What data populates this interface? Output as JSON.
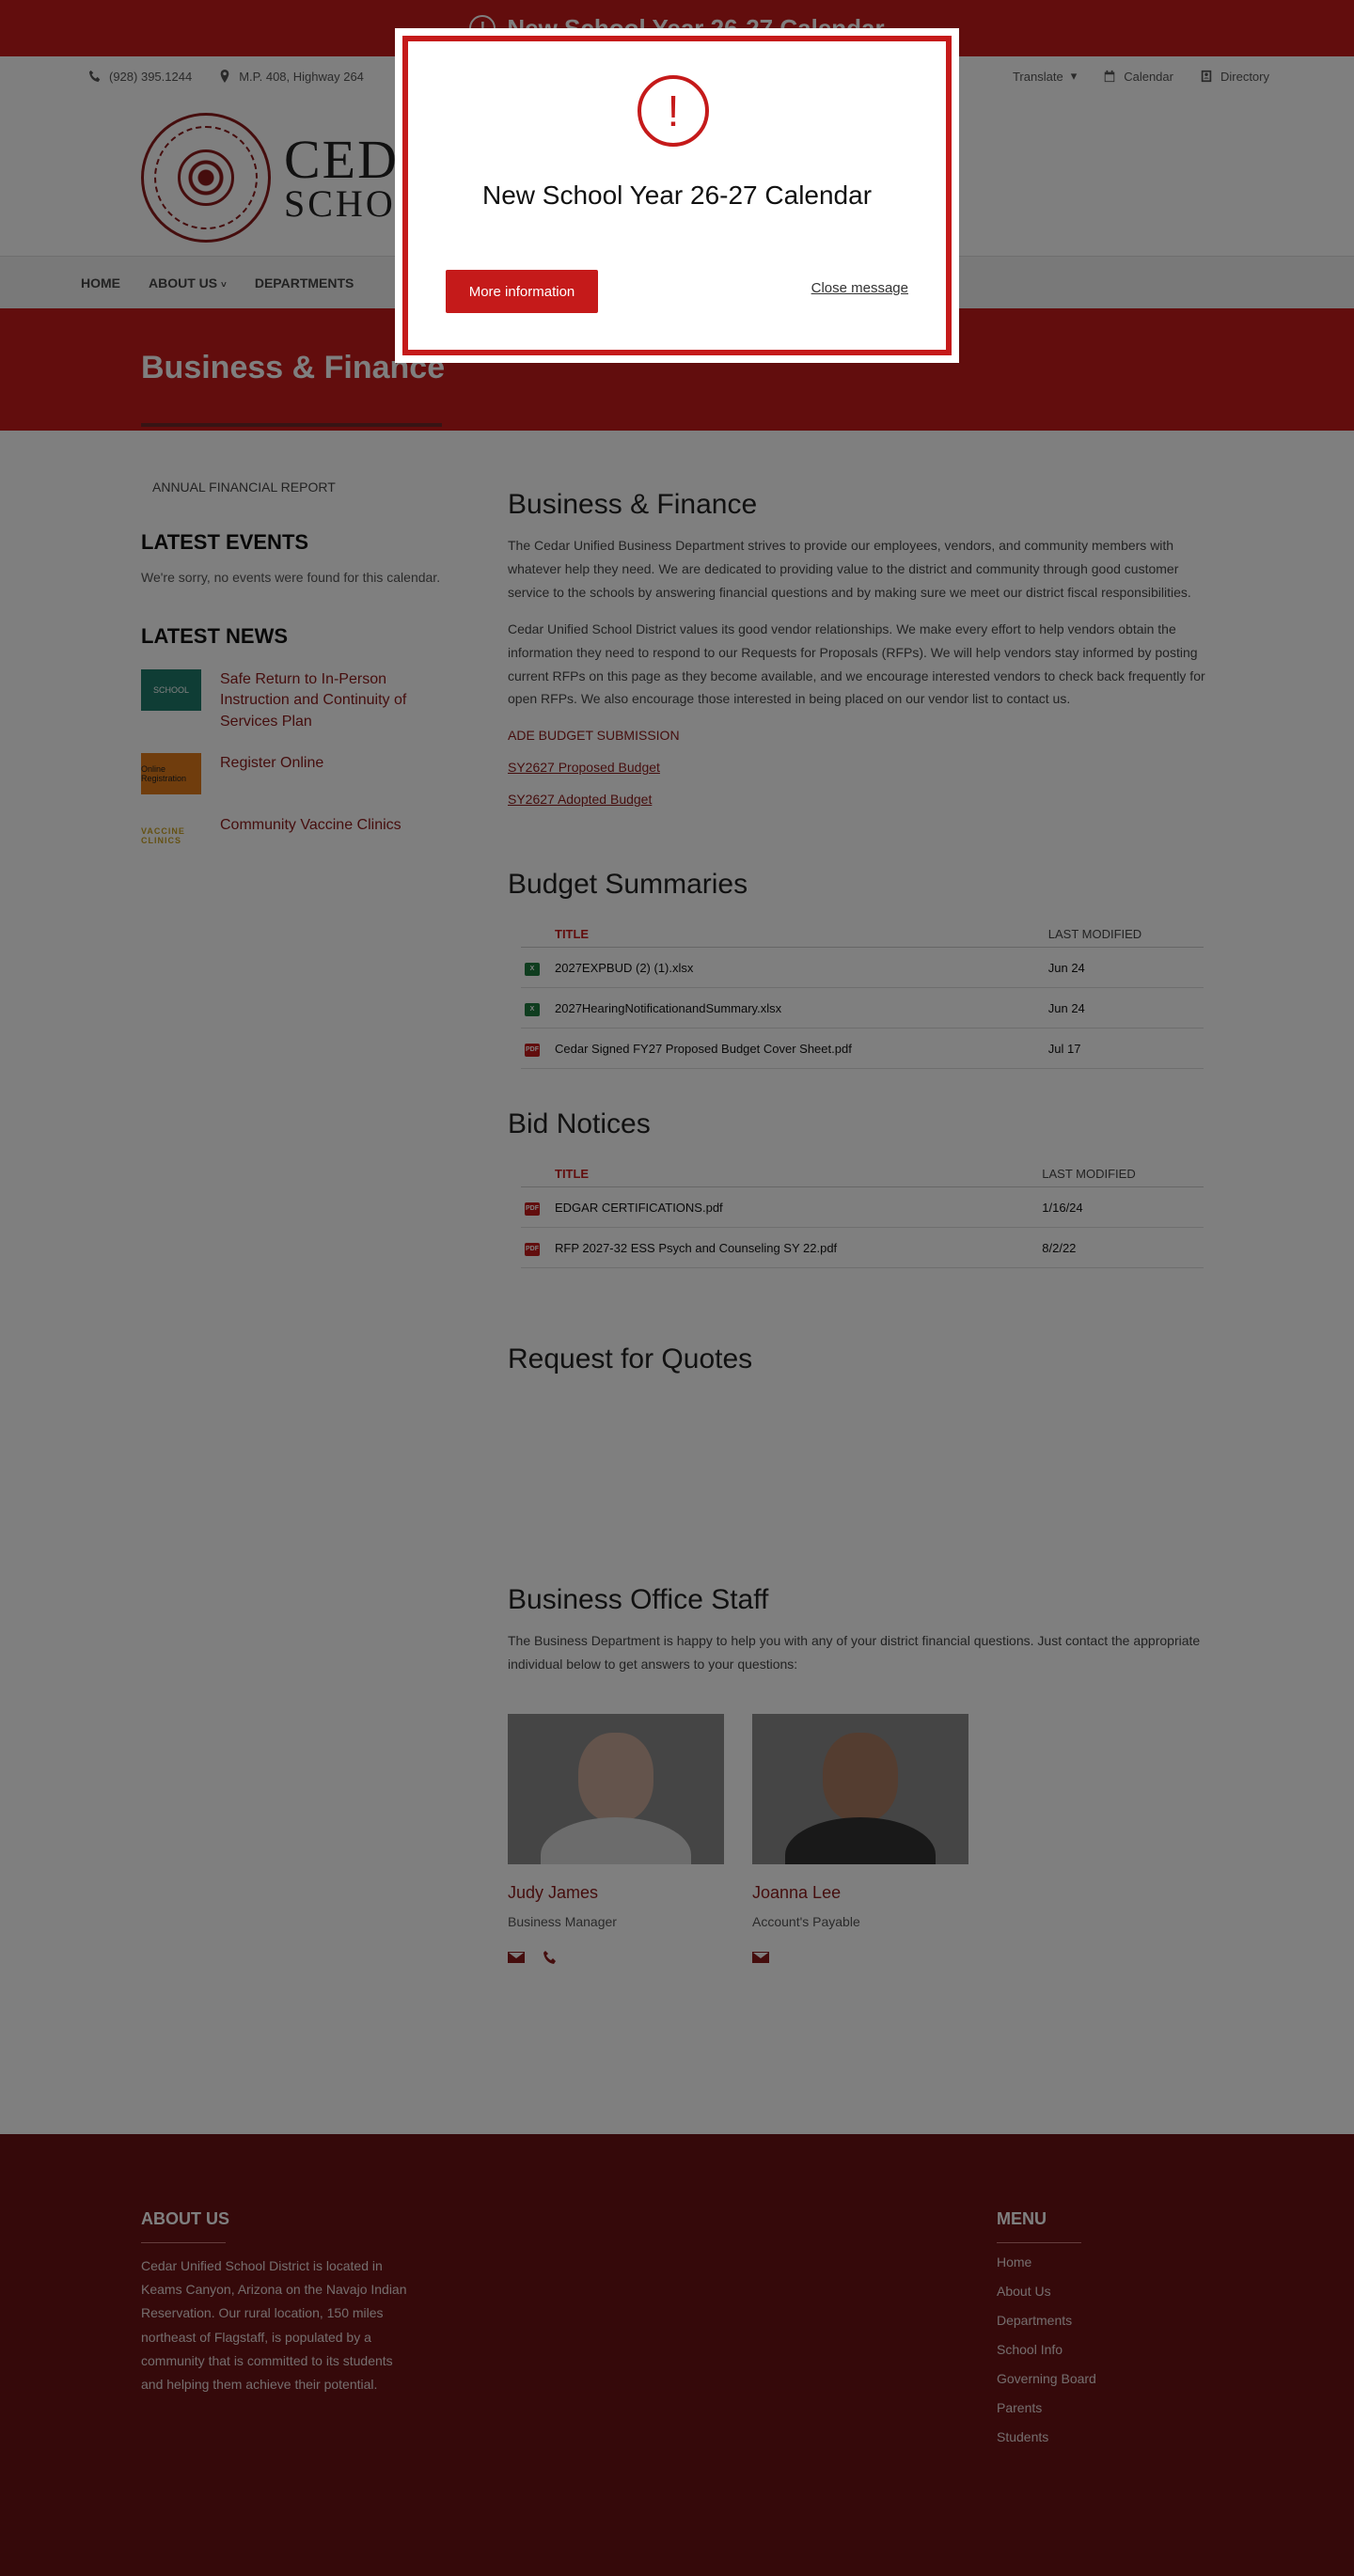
{
  "alert_bar": {
    "text": "New School Year 26-27 Calendar"
  },
  "utility": {
    "phone": "(928) 395.1244",
    "address": "M.P. 408, Highway 264",
    "translate": "Translate",
    "calendar": "Calendar",
    "directory": "Directory"
  },
  "brand": {
    "line1": "CEDAR",
    "line2": "SCHOOL"
  },
  "nav": {
    "items": [
      "HOME",
      "ABOUT US",
      "DEPARTMENTS"
    ]
  },
  "banner": {
    "title": "Business & Finance"
  },
  "sidebar": {
    "link": "ANNUAL FINANCIAL REPORT",
    "events_heading": "LATEST EVENTS",
    "events_empty": "We're sorry, no events were found for this calendar.",
    "news_heading": "LATEST NEWS",
    "news": [
      {
        "title": "Safe Return to In-Person Instruction and Continuity of Services Plan",
        "thumb_text": "SCHOOL",
        "thumb_color": "#1f7a6a"
      },
      {
        "title": "Register Online",
        "thumb_text": "Online Registration",
        "thumb_color": "#e07a1a"
      },
      {
        "title": "Community Vaccine Clinics",
        "thumb_text": "VACCINE CLINICS",
        "thumb_color": "#ffffff"
      }
    ]
  },
  "main": {
    "title": "Business & Finance",
    "para1": "The Cedar Unified Business Department strives to provide our employees, vendors, and community members with whatever help they need. We are dedicated to providing value to the district and community through good customer service to the schools by answering financial questions and by making sure we meet our district fiscal responsibilities.",
    "para2": "Cedar Unified School District values its good vendor relationships. We make every effort to help vendors obtain the information they need to respond to our Requests for Proposals (RFPs). We will help vendors stay informed by posting current RFPs on this page as they become available, and we encourage interested vendors to check back frequently for open RFPs. We also encourage those interested in being placed on our vendor list to contact us.",
    "ade_link": "ADE BUDGET SUBMISSION",
    "proposed_link": "SY2627 Proposed Budget",
    "adopted_link": "SY2627 Adopted Budget"
  },
  "budget": {
    "heading": "Budget Summaries",
    "col_title": "TITLE",
    "col_modified": "LAST MODIFIED",
    "rows": [
      {
        "type": "xlsx",
        "name": "2027EXPBUD (2) (1).xlsx",
        "modified": "Jun 24"
      },
      {
        "type": "xlsx",
        "name": "2027HearingNotificationandSummary.xlsx",
        "modified": "Jun 24"
      },
      {
        "type": "pdf",
        "name": "Cedar Signed FY27 Proposed Budget Cover Sheet.pdf",
        "modified": "Jul 17"
      }
    ]
  },
  "bids": {
    "heading": "Bid Notices",
    "col_title": "TITLE",
    "col_modified": "LAST MODIFIED",
    "rows": [
      {
        "type": "pdf",
        "name": "EDGAR CERTIFICATIONS.pdf",
        "modified": "1/16/24"
      },
      {
        "type": "pdf",
        "name": "RFP 2027-32 ESS Psych and Counseling SY 22.pdf",
        "modified": "8/2/22"
      }
    ]
  },
  "quotes": {
    "heading": "Request for Quotes"
  },
  "staff": {
    "heading": "Business Office Staff",
    "intro": "The Business Department is happy to help you with any of your district financial questions. Just contact the appropriate individual below to get answers to your questions:",
    "people": [
      {
        "name": "Judy James",
        "role": "Business Manager"
      },
      {
        "name": "Joanna Lee",
        "role": "Account's Payable"
      }
    ]
  },
  "footer": {
    "about_heading": "ABOUT US",
    "about_text": "Cedar Unified School District is located in Keams Canyon, Arizona on the Navajo Indian Reservation. Our rural location, 150 miles northeast of Flagstaff, is populated by a community that is committed to its students and helping them achieve their potential.",
    "menu_heading": "MENU",
    "menu": [
      "Home",
      "About Us",
      "Departments",
      "School Info",
      "Governing Board",
      "Parents",
      "Students"
    ]
  },
  "modal": {
    "icon": "!",
    "title": "New School Year 26-27 Calendar",
    "button": "More information",
    "close": "Close message"
  },
  "colors": {
    "brand_red": "#c51a1a",
    "dark_red": "#8a1a1a",
    "footer_bg": "#6b1214"
  }
}
